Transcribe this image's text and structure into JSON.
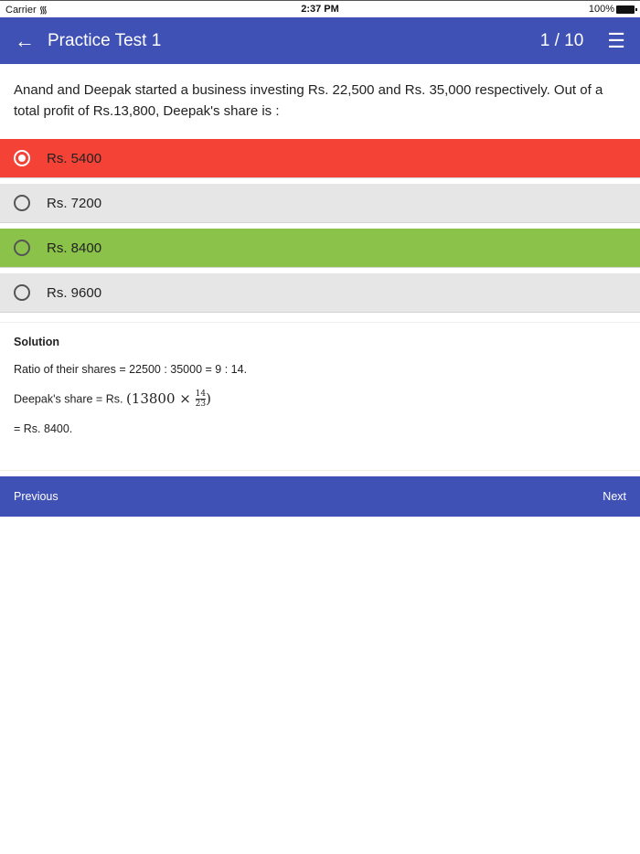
{
  "status_bar": {
    "carrier": "Carrier",
    "time": "2:37 PM",
    "battery": "100%"
  },
  "app_bar": {
    "title": "Practice Test 1",
    "progress": "1 / 10"
  },
  "question": "Anand and Deepak started a business investing Rs. 22,500 and Rs. 35,000 respectively. Out of a total profit of Rs.13,800, Deepak's share is :",
  "options": [
    {
      "label": "Rs. 5400",
      "state": "selected-wrong"
    },
    {
      "label": "Rs. 7200",
      "state": "neutral"
    },
    {
      "label": "Rs. 8400",
      "state": "correct"
    },
    {
      "label": "Rs. 9600",
      "state": "neutral"
    }
  ],
  "solution": {
    "heading": "Solution",
    "line1": "Ratio of their shares = 22500 : 35000 = 9 : 14.",
    "line2_prefix": "Deepak's share = Rs.",
    "line2_math_open": "(13800 ×",
    "line2_num": "14",
    "line2_den": "23",
    "line2_math_close": ")",
    "line3": "= Rs. 8400."
  },
  "footer": {
    "previous": "Previous",
    "next": "Next"
  }
}
